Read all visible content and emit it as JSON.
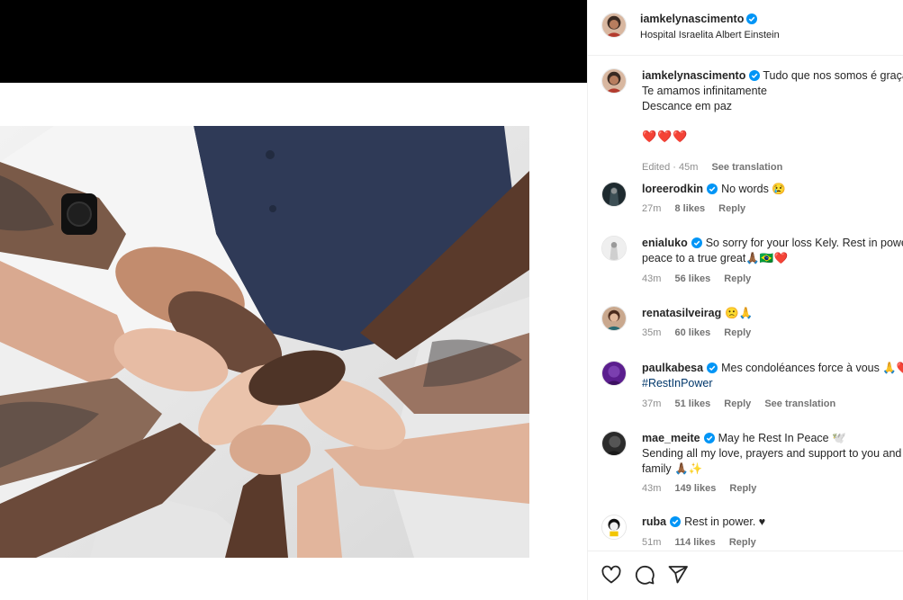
{
  "post": {
    "author": "iamkelynascimento",
    "location": "Hospital Israelita Albert Einstein"
  },
  "caption": {
    "username": "iamkelynascimento",
    "line1": "Tudo que nos somos é graça",
    "line2": "Te amamos infinitamente",
    "line3": "Descance em paz",
    "emoji": "❤️❤️❤️",
    "edited": "Edited · 45m",
    "see_translation": "See translation"
  },
  "comments": [
    {
      "username": "loreerodkin",
      "text": "No words 😢",
      "time": "27m",
      "likes": "8 likes",
      "reply": "Reply"
    },
    {
      "username": "enialuko",
      "text": "So sorry for your loss Kely. Rest in power",
      "text2": "peace to a true great🙏🏾🇧🇷❤️",
      "time": "43m",
      "likes": "56 likes",
      "reply": "Reply"
    },
    {
      "username": "renatasilveirag",
      "text": "🙁🙏",
      "time": "35m",
      "likes": "60 likes",
      "reply": "Reply"
    },
    {
      "username": "paulkabesa",
      "text": "Mes condoléances force à vous 🙏❤️",
      "text2": "#RestInPower",
      "time": "37m",
      "likes": "51 likes",
      "reply": "Reply",
      "see_translation": "See translation"
    },
    {
      "username": "mae_meite",
      "text": "May he Rest In Peace 🕊️",
      "text2": "Sending all my love, prayers and support to you and",
      "text3": "family 🙏🏾✨",
      "time": "43m",
      "likes": "149 likes",
      "reply": "Reply"
    },
    {
      "username": "ruba",
      "text": "Rest in power. ♥",
      "time": "51m",
      "likes": "114 likes",
      "reply": "Reply"
    }
  ],
  "icons": {
    "like": "heart-icon",
    "comment": "comment-icon",
    "share": "share-icon",
    "verified": "verified-badge-icon"
  },
  "colors": {
    "verified": "#0095f6",
    "muted": "#8e8e8e",
    "hashtag": "#00376b"
  }
}
